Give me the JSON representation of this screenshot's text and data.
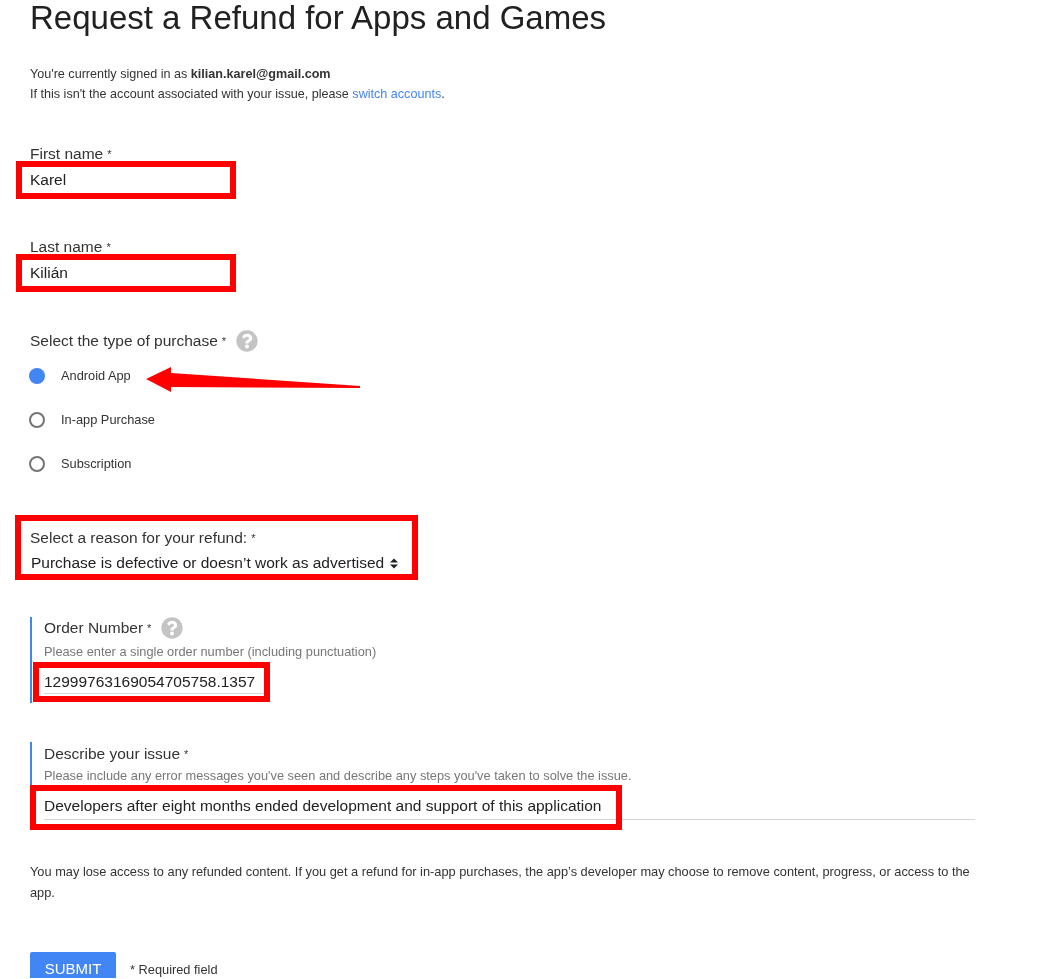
{
  "title": "Request a Refund for Apps and Games",
  "account": {
    "signed_in": "You're currently signed in as **kilian.karel@gmail.com**",
    "switch_prompt": "If this isn't the account associated with your issue, please",
    "switch_link": "switch accounts",
    "switch_end": "."
  },
  "fields": [
    {
      "kind": "text",
      "label": "First name",
      "required_mark": "*",
      "value": "Karel",
      "highlighted": true
    },
    {
      "kind": "text",
      "label": "Last name",
      "required_mark": "*",
      "value": "Kilián",
      "highlighted": true
    },
    {
      "kind": "radio",
      "label": "Select the type of purchase",
      "required_mark": "*",
      "help": true,
      "options": [
        {
          "label": "Android App",
          "selected": true,
          "arrow": true
        },
        {
          "label": "In-app Purchase",
          "selected": false,
          "arrow": false
        },
        {
          "label": "Subscription",
          "selected": false,
          "arrow": false
        }
      ]
    },
    {
      "kind": "select",
      "label": "Select a reason for your refund:",
      "required_mark": "*",
      "value": "Purchase is defective or doesn’t work as advertised",
      "highlighted": true
    },
    {
      "kind": "line",
      "label": "Order Number",
      "required_mark": "*",
      "help": true,
      "hint": "Please enter a single order number (including punctuation)",
      "value": "12999763169054705758.1357",
      "highlighted": true
    },
    {
      "kind": "line",
      "label": "Describe your issue",
      "required_mark": "*",
      "hint": "Please include any error messages you've seen and describe any steps you've taken to solve the issue.",
      "value": "Developers after eight months ended development and support of this application",
      "highlighted": true
    }
  ],
  "disclaimer": "You may lose access to any refunded content. If you get a refund for in-app purchases, the app’s developer may choose to remove content, progress, or access to the app.",
  "submit": "SUBMIT",
  "required_note": "* Required field"
}
